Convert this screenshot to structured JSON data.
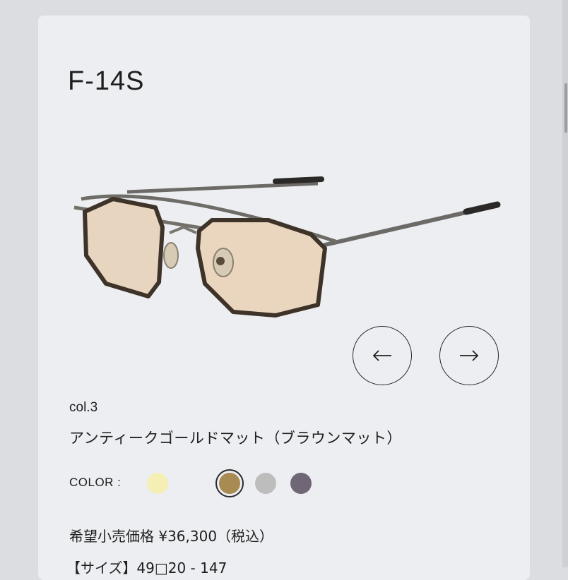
{
  "product": {
    "model": "F-14S",
    "color_code": "col.3",
    "color_name": "アンティークゴールドマット（ブラウンマット）",
    "color_label": "COLOR :",
    "price": "希望小売価格 ¥36,300（税込）",
    "size": "【サイズ】49□20 - 147"
  },
  "swatches": [
    {
      "color": "#f5efb5",
      "selected": false
    },
    {
      "color": "#eceef1",
      "selected": false
    },
    {
      "color": "#a88b52",
      "selected": true
    },
    {
      "color": "#bdbdbd",
      "selected": false
    },
    {
      "color": "#6f6676",
      "selected": false
    }
  ],
  "icons": {
    "prev": "arrow-left-icon",
    "next": "arrow-right-icon"
  }
}
